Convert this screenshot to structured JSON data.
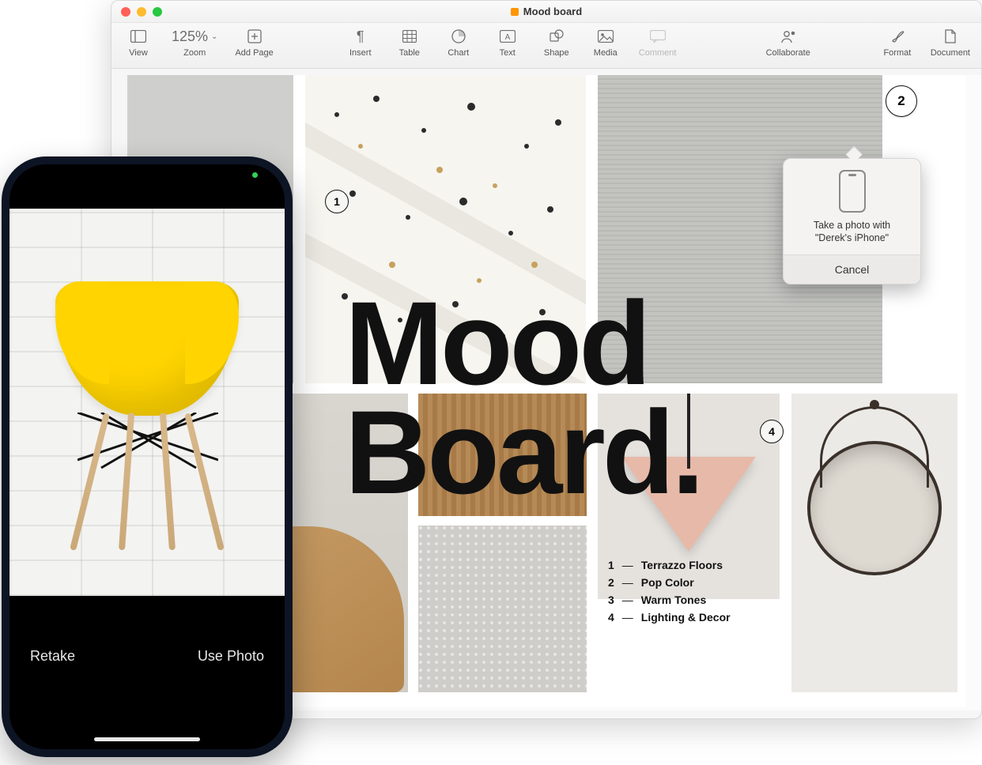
{
  "window": {
    "title": "Mood board"
  },
  "toolbar": {
    "view": "View",
    "zoom_label": "Zoom",
    "zoom_value": "125%",
    "add_page": "Add Page",
    "insert": "Insert",
    "table": "Table",
    "chart": "Chart",
    "text": "Text",
    "shape": "Shape",
    "media": "Media",
    "comment": "Comment",
    "collaborate": "Collaborate",
    "format": "Format",
    "document": "Document"
  },
  "document": {
    "title_line1": "Mood",
    "title_line2": "Board.",
    "markers": {
      "m1": "1",
      "m4": "4"
    },
    "legend": [
      {
        "n": "1",
        "label": "Terrazzo Floors"
      },
      {
        "n": "2",
        "label": "Pop Color"
      },
      {
        "n": "3",
        "label": "Warm Tones"
      },
      {
        "n": "4",
        "label": "Lighting & Decor"
      }
    ]
  },
  "callouts": {
    "c2": "2"
  },
  "popover": {
    "message_line1": "Take a photo with",
    "message_line2": "\"Derek's iPhone\"",
    "cancel": "Cancel"
  },
  "iphone": {
    "retake": "Retake",
    "use_photo": "Use Photo"
  }
}
